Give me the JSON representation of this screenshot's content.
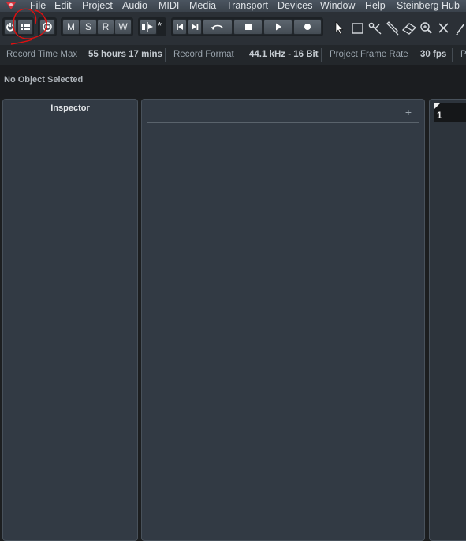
{
  "menu": {
    "items": [
      "File",
      "Edit",
      "Project",
      "Audio",
      "MIDI",
      "Media",
      "Transport",
      "Devices",
      "Window",
      "Help",
      "Steinberg Hub"
    ]
  },
  "toolbar": {
    "msrw": [
      "M",
      "S",
      "R",
      "W"
    ],
    "autoscroll_star": "*"
  },
  "info": {
    "record_time_max_label": "Record Time Max",
    "record_time_max_value": "55 hours 17 mins",
    "record_format_label": "Record Format",
    "record_format_value": "44.1 kHz - 16 Bit",
    "frame_rate_label": "Project Frame Rate",
    "frame_rate_value": "30 fps",
    "cut_label": "P"
  },
  "status": {
    "text": "No Object Selected"
  },
  "inspector": {
    "title": "Inspector"
  },
  "tracklist": {
    "add_symbol": "+"
  },
  "ruler": {
    "bar_number": "1"
  },
  "colors": {
    "panel": "#323a44",
    "background": "#1c1e20",
    "annotation": "#e01010"
  }
}
